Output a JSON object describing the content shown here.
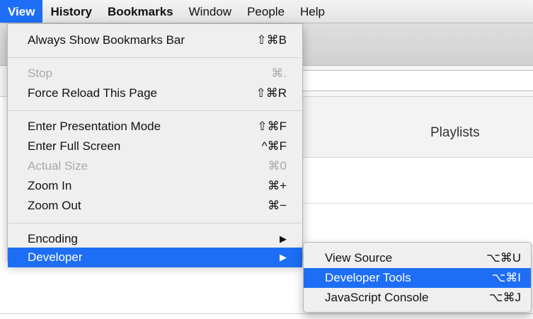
{
  "menubar": {
    "items": [
      {
        "label": "View",
        "active": true
      },
      {
        "label": "History"
      },
      {
        "label": "Bookmarks"
      },
      {
        "label": "Window"
      },
      {
        "label": "People"
      },
      {
        "label": "Help"
      }
    ]
  },
  "page": {
    "pane_title": "Playlists"
  },
  "view_menu": {
    "items": [
      {
        "label": "Always Show Bookmarks Bar",
        "shortcut": "⇧⌘B"
      },
      {
        "label": "Stop",
        "shortcut": "⌘.",
        "disabled": true
      },
      {
        "label": "Force Reload This Page",
        "shortcut": "⇧⌘R"
      },
      {
        "label": "Enter Presentation Mode",
        "shortcut": "⇧⌘F"
      },
      {
        "label": "Enter Full Screen",
        "shortcut": "^⌘F"
      },
      {
        "label": "Actual Size",
        "shortcut": "⌘0",
        "disabled": true
      },
      {
        "label": "Zoom In",
        "shortcut": "⌘+"
      },
      {
        "label": "Zoom Out",
        "shortcut": "⌘−"
      },
      {
        "label": "Encoding",
        "submenu_icon": "submenu-arrow-icon"
      },
      {
        "label": "Developer",
        "submenu_icon": "submenu-arrow-icon",
        "highlighted": true
      }
    ]
  },
  "developer_menu": {
    "items": [
      {
        "label": "View Source",
        "shortcut": "⌥⌘U"
      },
      {
        "label": "Developer Tools",
        "shortcut": "⌥⌘I",
        "highlighted": true
      },
      {
        "label": "JavaScript Console",
        "shortcut": "⌥⌘J"
      }
    ]
  },
  "colors": {
    "highlight": "#1d6ef5",
    "disabled_text": "#a9a9a9",
    "menu_background": "#efefef"
  }
}
